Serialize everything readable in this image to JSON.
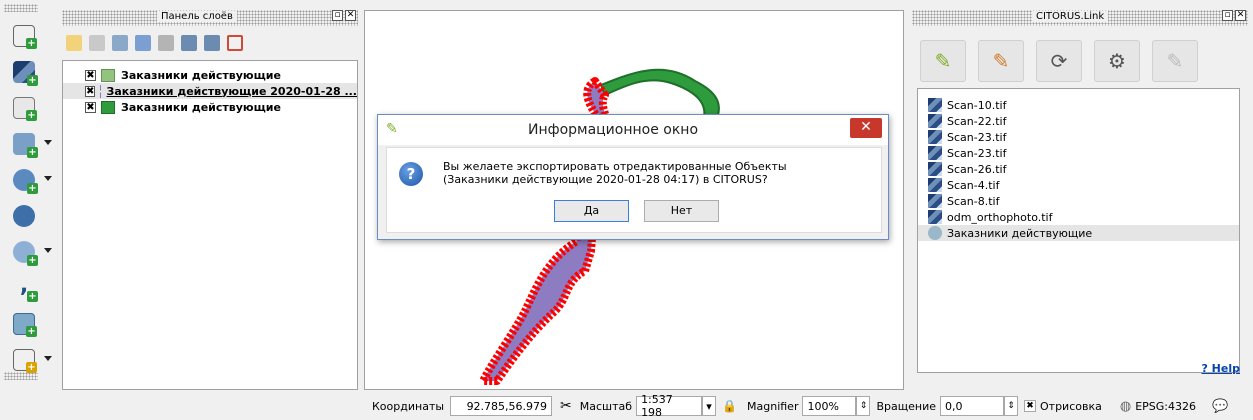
{
  "layer_panel": {
    "title": "Панель слоёв",
    "layers": [
      {
        "label": "Заказники действующие",
        "checked": "✖",
        "swatch": "#93c47d"
      },
      {
        "label": "Заказники действующие 2020-01-28 ...",
        "checked": "✖",
        "swatch": "#8e7cc3"
      },
      {
        "label": "Заказники действующие",
        "checked": "✖",
        "swatch": "#2e9b3c"
      }
    ]
  },
  "citorus_panel": {
    "title": "CITORUS.Link",
    "files": [
      "Scan-10.tif",
      "Scan-22.tif",
      "Scan-23.tif",
      "Scan-23.tif",
      "Scan-26.tif",
      "Scan-4.tif",
      "Scan-8.tif",
      "odm_orthophoto.tif",
      "Заказники действующие"
    ],
    "help": "? Help"
  },
  "dialog": {
    "title": "Информационное окно",
    "message": "Вы желаете экспортировать отредактированные Объекты (Заказники действующие 2020-01-28 04:17) в CITORUS?",
    "yes": "Да",
    "no": "Нет",
    "close": "✕"
  },
  "status": {
    "coords_label": "Координаты",
    "coords_value": "92.785,56.979",
    "scale_label": "Масштаб",
    "scale_value": "1:537 198",
    "magnifier_label": "Magnifier",
    "magnifier_value": "100%",
    "rotation_label": "Вращение",
    "rotation_value": "0,0",
    "render_label": "Отрисовка",
    "crs": "EPSG:4326"
  },
  "colors": {
    "accent": "#c8372c",
    "feature_fill": "#8e7cc3",
    "feature_edge": "#ff0000",
    "green_feature": "#2e9b3c"
  }
}
